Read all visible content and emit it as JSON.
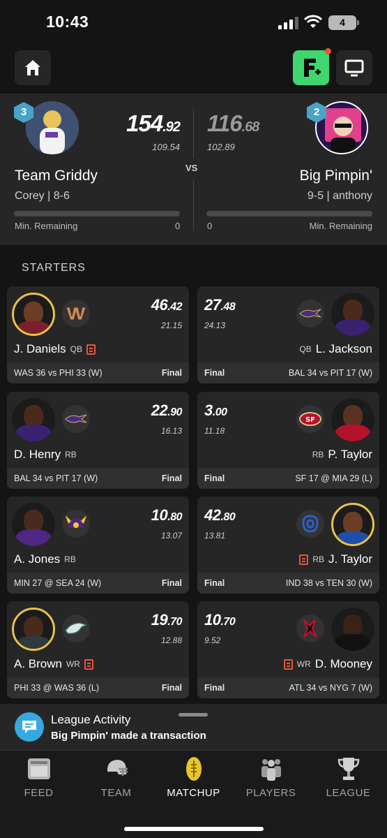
{
  "status_bar": {
    "time": "10:43",
    "battery": "4"
  },
  "matchup": {
    "vs_label": "VS",
    "left": {
      "rank": "3",
      "score_int": "154",
      "score_dec": ".92",
      "projected": "109.54",
      "team_name": "Team Griddy",
      "subline": "Corey | 8-6",
      "min_remaining_label": "Min. Remaining",
      "min_remaining_value": "0"
    },
    "right": {
      "rank": "2",
      "score_int": "116",
      "score_dec": ".68",
      "projected": "102.89",
      "team_name": "Big Pimpin'",
      "subline": "9-5 | anthony",
      "min_remaining_label": "Min. Remaining",
      "min_remaining_value": "0"
    }
  },
  "section_title": "STARTERS",
  "final_label": "Final",
  "starters": [
    {
      "left": {
        "pts_int": "46",
        "pts_dec": ".42",
        "proj": "21.15",
        "name": "J. Daniels",
        "pos": "QB",
        "game": "WAS 36 vs PHI 33 (W)",
        "team_icon": "commanders-logo-icon"
      },
      "right": {
        "pts_int": "27",
        "pts_dec": ".48",
        "proj": "24.13",
        "name": "L. Jackson",
        "pos": "QB",
        "game": "BAL 34 vs PIT 17 (W)",
        "team_icon": "ravens-logo-icon"
      }
    },
    {
      "left": {
        "pts_int": "22",
        "pts_dec": ".90",
        "proj": "16.13",
        "name": "D. Henry",
        "pos": "RB",
        "game": "BAL 34 vs PIT 17 (W)",
        "team_icon": "ravens-logo-icon"
      },
      "right": {
        "pts_int": "3",
        "pts_dec": ".00",
        "proj": "11.18",
        "name": "P. Taylor",
        "pos": "RB",
        "game": "SF 17 @ MIA 29 (L)",
        "team_icon": "49ers-logo-icon"
      }
    },
    {
      "left": {
        "pts_int": "10",
        "pts_dec": ".80",
        "proj": "13.07",
        "name": "A. Jones",
        "pos": "RB",
        "game": "MIN 27 @ SEA 24 (W)",
        "team_icon": "vikings-logo-icon"
      },
      "right": {
        "pts_int": "42",
        "pts_dec": ".80",
        "proj": "13.81",
        "name": "J. Taylor",
        "pos": "RB",
        "game": "IND 38 vs TEN 30 (W)",
        "team_icon": "colts-logo-icon"
      }
    },
    {
      "left": {
        "pts_int": "19",
        "pts_dec": ".70",
        "proj": "12.88",
        "name": "A. Brown",
        "pos": "WR",
        "game": "PHI 33 @ WAS 36 (L)",
        "team_icon": "eagles-logo-icon"
      },
      "right": {
        "pts_int": "10",
        "pts_dec": ".70",
        "proj": "9.52",
        "name": "D. Mooney",
        "pos": "WR",
        "game": "ATL 34 vs NYG 7 (W)",
        "team_icon": "falcons-logo-icon"
      }
    }
  ],
  "activity": {
    "title": "League Activity",
    "subtitle": "Big Pimpin' made a transaction"
  },
  "tabs": [
    {
      "label": "FEED",
      "icon": "feed-icon"
    },
    {
      "label": "TEAM",
      "icon": "helmet-icon"
    },
    {
      "label": "MATCHUP",
      "icon": "football-icon"
    },
    {
      "label": "PLAYERS",
      "icon": "players-icon"
    },
    {
      "label": "LEAGUE",
      "icon": "trophy-icon"
    }
  ],
  "colors": {
    "background": "#141414",
    "card": "#262626",
    "accent_green": "#3fd66f",
    "gold_ring": "#e9c24a",
    "news_icon": "#e8553a",
    "activity_blue": "#35a9e0",
    "rank_badge": "#49a3c7"
  }
}
